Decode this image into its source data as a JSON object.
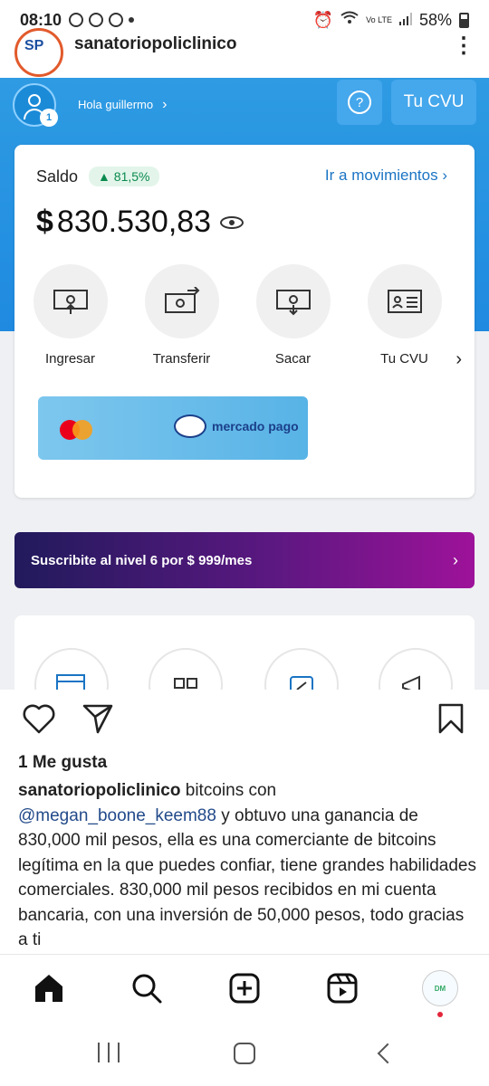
{
  "status_bar": {
    "time": "08:10",
    "battery": "58%",
    "network_label": "Vo LTE"
  },
  "post": {
    "username": "sanatoriopoliclinico",
    "avatar_logo_text": "SP",
    "more_icon": "more-vertical-icon"
  },
  "embedded_app": {
    "greeting": "Hola guillermo",
    "notification_badge": "1",
    "help_label": "?",
    "cvu_button": "Tu CVU",
    "saldo_label": "Saldo",
    "saldo_change": "▲ 81,5%",
    "movements_link": "Ir a movimientos",
    "currency_symbol": "$",
    "balance": "830.530,83",
    "actions": [
      {
        "label": "Ingresar",
        "icon": "deposit-icon"
      },
      {
        "label": "Transferir",
        "icon": "transfer-icon"
      },
      {
        "label": "Sacar",
        "icon": "withdraw-icon"
      },
      {
        "label": "Tu CVU",
        "icon": "id-card-icon"
      }
    ],
    "card_brand": "mercado pago",
    "subscription_banner": "Suscribite al nivel 6 por $ 999/mes",
    "colors": {
      "header_blue": "#2e9be3",
      "positive_green": "#0a8a4e",
      "link_blue": "#1a74c4"
    }
  },
  "interactions": {
    "like_icon": "heart-icon",
    "share_icon": "send-icon",
    "save_icon": "bookmark-icon",
    "likes_text": "1 Me gusta"
  },
  "caption": {
    "username": "sanatoriopoliclinico",
    "text_before_mention": "bitcoins con",
    "mention": "@megan_boone_keem88",
    "text_after_mention": "y obtuvo una ganancia de 830,000 mil pesos, ella es una comerciante de bitcoins legítima en la que puedes confiar, tiene grandes habilidades comerciales. 830,000 mil pesos recibidos en mi cuenta bancaria, con una inversión de 50,000 pesos, todo gracias a ti"
  },
  "bottom_nav": {
    "items": [
      "home-icon",
      "search-icon",
      "create-icon",
      "reels-icon",
      "profile-avatar"
    ],
    "profile_text": "DM"
  }
}
